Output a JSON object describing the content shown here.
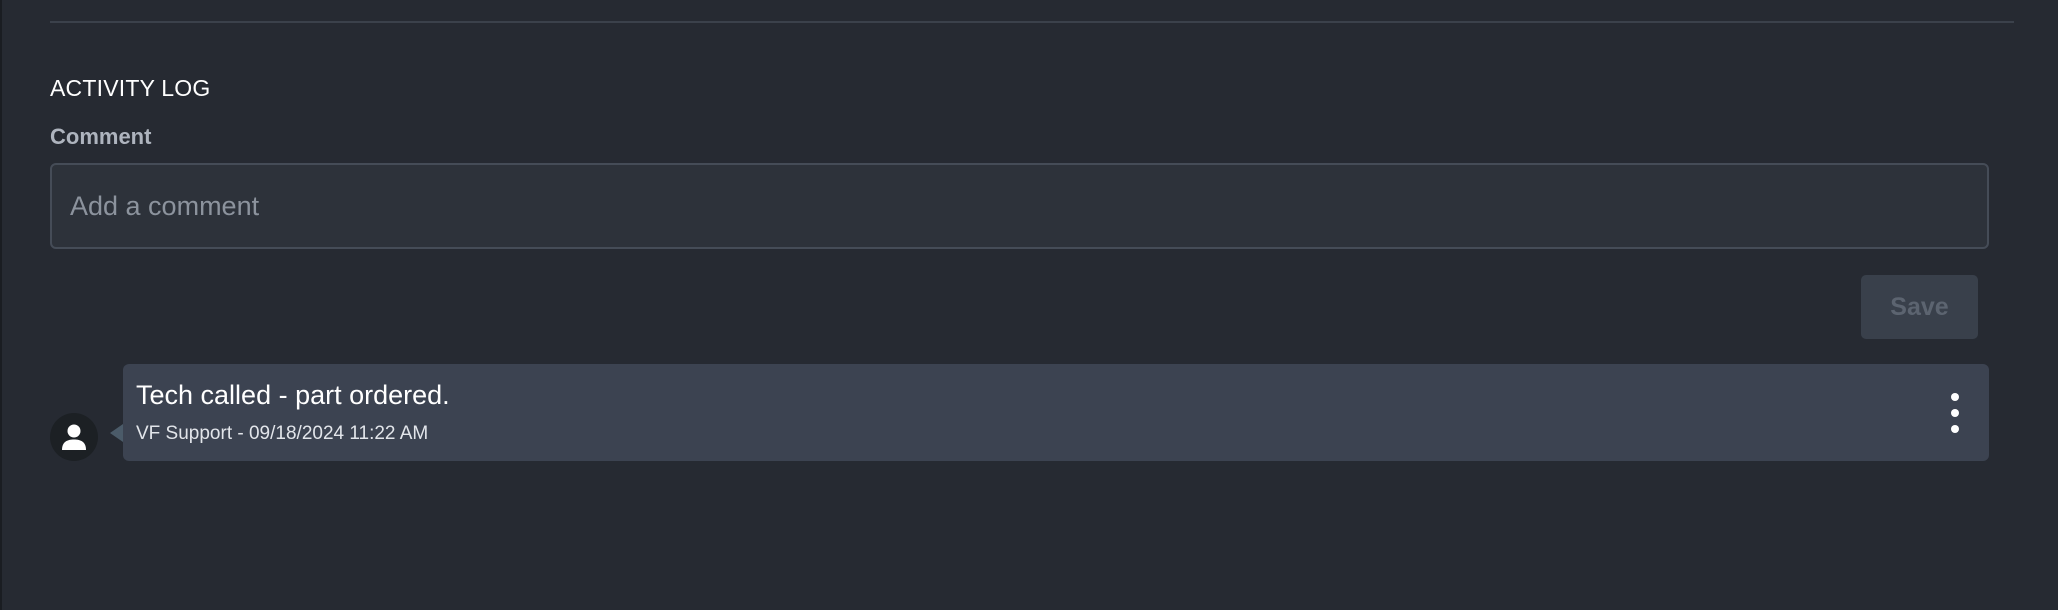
{
  "activity_log": {
    "title": "ACTIVITY LOG",
    "comment_label": "Comment",
    "comment_placeholder": "Add a comment",
    "comment_value": "",
    "save_label": "Save",
    "entries": [
      {
        "text": "Tech called - part ordered.",
        "meta": "VF Support - 09/18/2024 11:22 AM",
        "avatar_icon": "user-icon",
        "menu_icon": "more-vertical-icon"
      }
    ]
  },
  "colors": {
    "background": "#262a32",
    "entry_background": "#3c4351",
    "save_button_background": "#39404b",
    "save_button_text": "#5c6470"
  }
}
